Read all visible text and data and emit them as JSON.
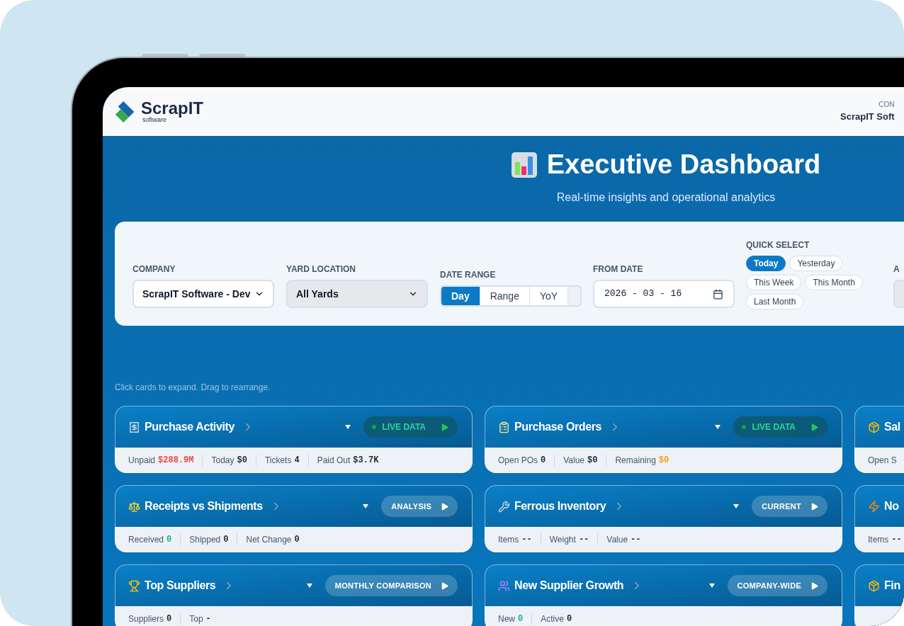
{
  "header": {
    "logo": {
      "name": "ScrapIT",
      "tagline": "software"
    },
    "company_label": "CON",
    "company_name": "ScrapIT Soft"
  },
  "hero": {
    "title": "Executive Dashboard",
    "subtitle": "Real-time insights and operational analytics"
  },
  "filters": {
    "company": {
      "label": "COMPANY",
      "value": "ScrapIT Software - Dev"
    },
    "yard": {
      "label": "YARD LOCATION",
      "value": "All Yards"
    },
    "date_range": {
      "label": "DATE RANGE",
      "options": [
        {
          "label": "Day",
          "selected": true
        },
        {
          "label": "Range",
          "selected": false
        },
        {
          "label": "YoY",
          "selected": false
        }
      ]
    },
    "from_date": {
      "label": "FROM DATE",
      "value": "2026 - 03 - 16"
    },
    "quick_select": {
      "label": "QUICK SELECT",
      "options": [
        {
          "label": "Today",
          "selected": true
        },
        {
          "label": "Yesterday",
          "selected": false
        },
        {
          "label": "This Week",
          "selected": false
        },
        {
          "label": "This Month",
          "selected": false
        },
        {
          "label": "Last Month",
          "selected": false
        }
      ]
    },
    "column_6": {
      "label": "A"
    }
  },
  "hint": "Click cards to expand. Drag to rearrange.",
  "cards": [
    {
      "title": "Purchase Activity",
      "badge": {
        "kind": "live",
        "label": "LIVE DATA"
      },
      "stats": [
        {
          "label": "Unpaid",
          "value": "$288.9M",
          "color": "#ef4444"
        },
        {
          "label": "Today",
          "value": "$0"
        },
        {
          "label": "Tickets",
          "value": "4"
        },
        {
          "label": "Paid Out",
          "value": "$3.7K"
        }
      ]
    },
    {
      "title": "Purchase Orders",
      "badge": {
        "kind": "live",
        "label": "LIVE DATA"
      },
      "stats": [
        {
          "label": "Open POs",
          "value": "0"
        },
        {
          "label": "Value",
          "value": "$0"
        },
        {
          "label": "Remaining",
          "value": "$0",
          "color": "#f59e0b"
        }
      ]
    },
    {
      "title": "Sal",
      "stats": [
        {
          "label": "Open S"
        }
      ]
    },
    {
      "title": "Receipts vs Shipments",
      "badge": {
        "kind": "tag",
        "label": "ANALYSIS"
      },
      "stats": [
        {
          "label": "Received",
          "value": "0",
          "color": "#10b981"
        },
        {
          "label": "Shipped",
          "value": "0"
        },
        {
          "label": "Net Change",
          "value": "0"
        }
      ]
    },
    {
      "title": "Ferrous Inventory",
      "badge": {
        "kind": "tag",
        "label": "CURRENT"
      },
      "stats": [
        {
          "label": "Items",
          "value": "--"
        },
        {
          "label": "Weight",
          "value": "--"
        },
        {
          "label": "Value",
          "value": "--"
        }
      ]
    },
    {
      "title": "No",
      "stats": [
        {
          "label": "Items",
          "value": "--"
        }
      ]
    },
    {
      "title": "Top Suppliers",
      "badge": {
        "kind": "tag",
        "label": "MONTHLY COMPARISON"
      },
      "stats": [
        {
          "label": "Suppliers",
          "value": "0"
        },
        {
          "label": "Top",
          "value": "-"
        }
      ]
    },
    {
      "title": "New Supplier Growth",
      "badge": {
        "kind": "tag",
        "label": "COMPANY-WIDE"
      },
      "stats": [
        {
          "label": "New",
          "value": "0",
          "color": "#10b981"
        },
        {
          "label": "Active",
          "value": "0"
        }
      ]
    },
    {
      "title": "Fin"
    }
  ]
}
